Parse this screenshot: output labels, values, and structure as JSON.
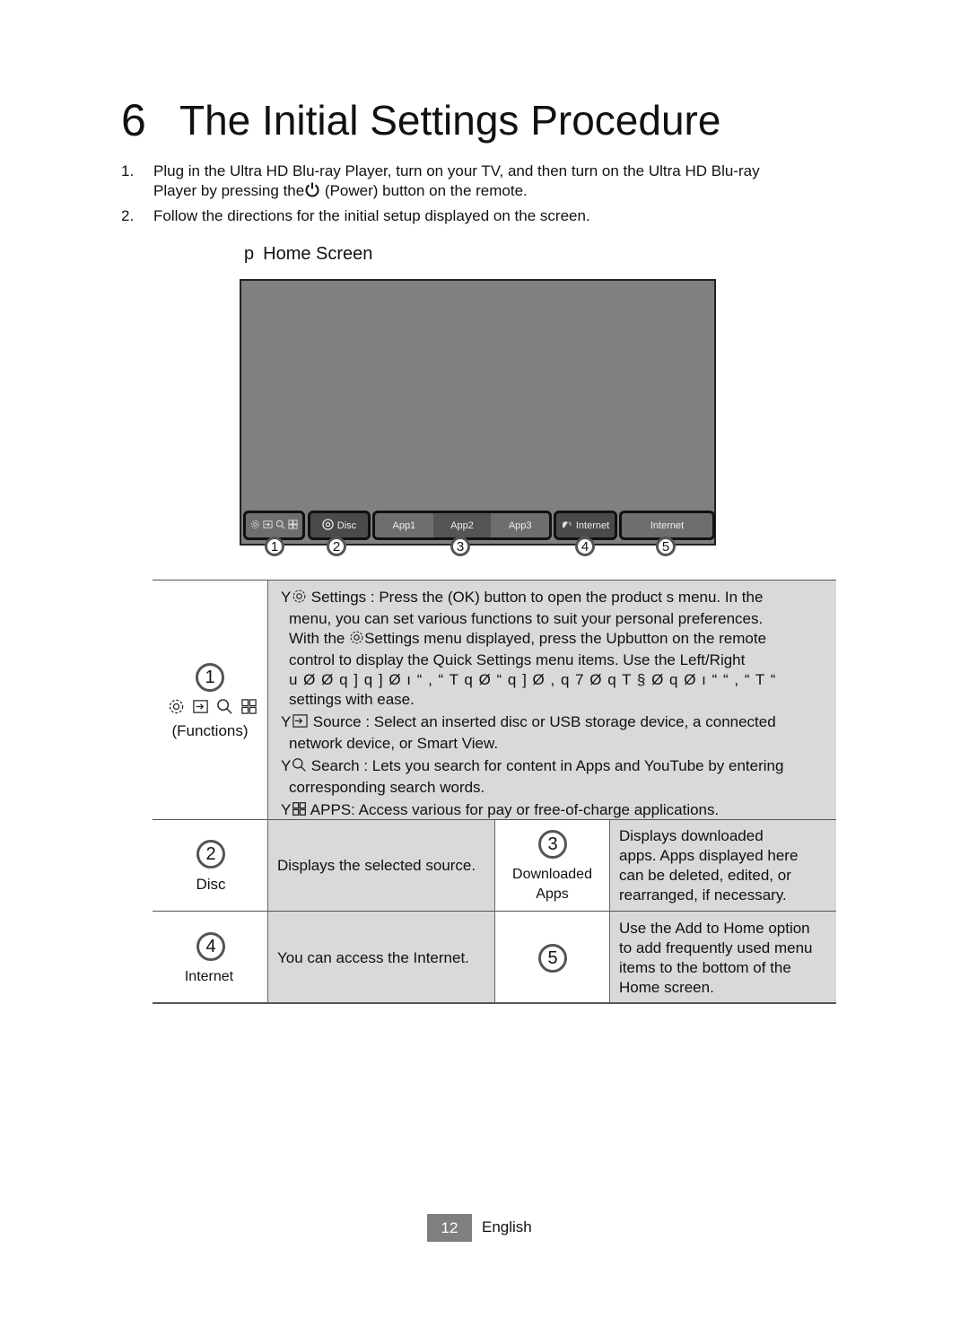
{
  "page": {
    "chapter_number": "6",
    "title": "The Initial Settings Procedure",
    "steps": [
      {
        "num": "1.",
        "line1": "Plug in the Ultra HD Blu-ray Player, turn on your TV, and then turn on the Ultra HD Blu-ray",
        "line2_before": "Player by pressing the",
        "line2_after": " (Power) button on the remote."
      },
      {
        "num": "2.",
        "line1": "Follow the directions for the initial setup displayed on the screen."
      }
    ],
    "section_marker": "p",
    "section_title": "Home Screen"
  },
  "home_screen": {
    "bar": {
      "disc_label": "Disc",
      "apps": [
        "App1",
        "App2",
        "App3"
      ],
      "selected_app_index": 1,
      "internet_label": "Internet",
      "internet2_label": "Internet"
    },
    "callouts": [
      "1",
      "2",
      "3",
      "4",
      "5"
    ]
  },
  "table": {
    "row1": {
      "callout": "1",
      "label": "(Functions)",
      "items": [
        {
          "icon": "settings-icon",
          "lines": [
            "Settings : Press the    (OK) button to open the product s menu. In the",
            "menu, you can set various functions to suit your personal preferences.",
            "With the",
            "Settings menu displayed, press the Upbutton on the remote",
            "control to display the Quick Settings  menu items. Use the Left/Right",
            "u  Ø Ø q ]    q ]  Ø ı “  , “ T q Ø “    q ] Ø , q 7   Ø q      T §   Ø q   Ø ı “     “     , “    T “",
            "settings with ease."
          ]
        },
        {
          "icon": "source-icon",
          "lines": [
            "Source : Select an inserted disc or USB storage device, a connected",
            "network device, or Smart View."
          ]
        },
        {
          "icon": "search-icon",
          "lines": [
            "Search : Lets you search for content in Apps and YouTube by entering",
            "corresponding search words."
          ]
        },
        {
          "icon": "apps-icon",
          "lines": [
            "APPS: Access various for pay or free-of-charge applications."
          ]
        }
      ]
    },
    "row2": {
      "left": {
        "callout": "2",
        "label": "Disc",
        "description": "Displays the selected source."
      },
      "right": {
        "callout": "3",
        "label_line1": "Downloaded",
        "label_line2": "Apps",
        "description": [
          "Displays downloaded",
          "apps. Apps displayed here",
          "can be deleted, edited, or",
          "rearranged, if necessary."
        ]
      }
    },
    "row3": {
      "left": {
        "callout": "4",
        "label": "Internet",
        "description": "You can access the Internet."
      },
      "right": {
        "callout": "5",
        "description": [
          "Use the Add to Home option",
          "to add frequently used menu",
          "items to the bottom of the",
          "Home screen."
        ]
      }
    }
  },
  "footer": {
    "page_number": "12",
    "language": "English"
  }
}
